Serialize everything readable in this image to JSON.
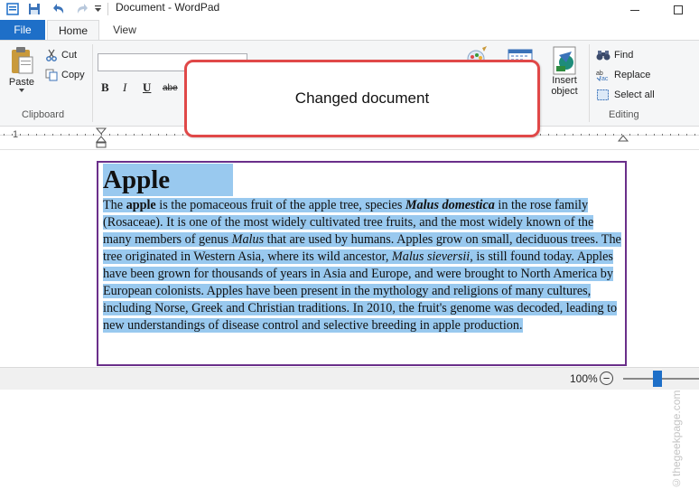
{
  "window": {
    "title": "Document - WordPad",
    "controls": {
      "minimize_icon": "minimize-icon",
      "maximize_icon": "maximize-icon"
    }
  },
  "tabs": {
    "file": "File",
    "home": "Home",
    "view": "View"
  },
  "ribbon": {
    "clipboard": {
      "paste": "Paste",
      "cut": "Cut",
      "copy": "Copy",
      "label": "Clipboard"
    },
    "font": {
      "bold": "B",
      "italic": "I",
      "underline": "U",
      "strike": "abe"
    },
    "insert": {
      "insert_object_line1": "Insert",
      "insert_object_line2": "object"
    },
    "editing": {
      "find": "Find",
      "replace": "Replace",
      "select_all": "Select all",
      "label": "Editing"
    }
  },
  "ruler": {
    "mark": "1"
  },
  "callout": {
    "text": "Changed document"
  },
  "document": {
    "title": "Apple",
    "paragraph": {
      "t1": "The ",
      "b1": "apple",
      "t2": " is the pomaceous fruit of the apple tree, species ",
      "bi1": "Malus domestica",
      "t3": " in the rose family (Rosaceae). It is one of the most widely cultivated tree fruits, and the most widely known of the many members of genus ",
      "i1": "Malus",
      "t4": " that are used by humans. Apples grow on small, deciduous trees. The tree originated in Western Asia, where its wild ancestor, ",
      "i2": "Malus sieversii",
      "t5": ", is still found today. Apples have been grown for thousands of years in Asia and Europe, and were brought to North America by European colonists. Apples have been present in the mythology and religions of many cultures, including Norse, Greek and Christian traditions. In 2010, the fruit's genome was decoded, leading to new understandings of disease control and selective breeding in apple production."
    }
  },
  "watermark": "©thegeekpage.com",
  "status": {
    "zoom": "100%",
    "zoom_out": "−",
    "zoom_level": 0.45
  }
}
